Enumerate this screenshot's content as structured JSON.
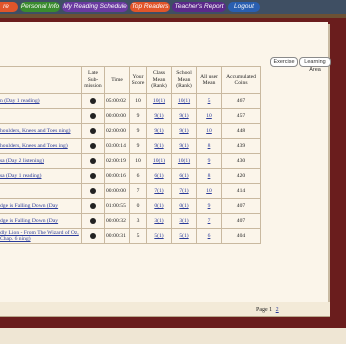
{
  "nav": {
    "tabs": [
      {
        "label": "re",
        "color": "#e0552a"
      },
      {
        "label": "Personal Info",
        "color": "#3a8b2e"
      },
      {
        "label": "My Reading Schedule",
        "color": "#6a3aa0"
      },
      {
        "label": "Top Readers",
        "color": "#e0552a"
      },
      {
        "label": "Teacher's Report",
        "color": "#5b2a8a"
      },
      {
        "label": "Logout",
        "color": "#2a5fb0"
      }
    ]
  },
  "subtabs": {
    "exercise": "Exercise",
    "learning_area": "Learning Area"
  },
  "headers": {
    "late": "Late Sub- mission",
    "time": "Time",
    "score": "Your Score",
    "class": "Class Mean (Rank)",
    "school": "School Mean (Rank)",
    "all": "All user Mean",
    "coins": "Accumulated Coins"
  },
  "rows": [
    {
      "title": "n (Day 1 reading)",
      "time": "05:00:02",
      "score": "10",
      "class": "10(1)",
      "school": "10(1)",
      "all": "5",
      "coins": "467"
    },
    {
      "title": "",
      "time": "00:00:00",
      "score": "9",
      "class": "9(1)",
      "school": "9(1)",
      "all": "10",
      "coins": "457"
    },
    {
      "title": "houlders, Knees and Toes ning)",
      "time": "02:00:00",
      "score": "9",
      "class": "9(1)",
      "school": "9(1)",
      "all": "10",
      "coins": "448"
    },
    {
      "title": "houlders, Knees and Toes ing)",
      "time": "03:00:14",
      "score": "9",
      "class": "9(1)",
      "school": "9(1)",
      "all": "8",
      "coins": "439"
    },
    {
      "title": "sa (Day 2 listening)",
      "time": "02:00:19",
      "score": "10",
      "class": "10(1)",
      "school": "10(1)",
      "all": "9",
      "coins": "430"
    },
    {
      "title": "sa (Day 1 reading)",
      "time": "00:00:16",
      "score": "6",
      "class": "6(1)",
      "school": "6(1)",
      "all": "8",
      "coins": "420"
    },
    {
      "title": "",
      "time": "00:00:00",
      "score": "7",
      "class": "7(1)",
      "school": "7(1)",
      "all": "10",
      "coins": "414"
    },
    {
      "title": "dge is Falling Down (Day",
      "time": "01:00:55",
      "score": "0",
      "class": "0(1)",
      "school": "0(1)",
      "all": "9",
      "coins": "407"
    },
    {
      "title": "dge is Falling Down (Day",
      "time": "00:00:32",
      "score": "3",
      "class": "3(1)",
      "school": "3(1)",
      "all": "7",
      "coins": "407"
    },
    {
      "title": "dly Lion - From The Wizard of Oz, Chap. 6 ning)",
      "time": "00:00:31",
      "score": "5",
      "class": "5(1)",
      "school": "5(1)",
      "all": "6",
      "coins": "404"
    }
  ],
  "pager": {
    "label": "Page 1",
    "next": "2"
  }
}
